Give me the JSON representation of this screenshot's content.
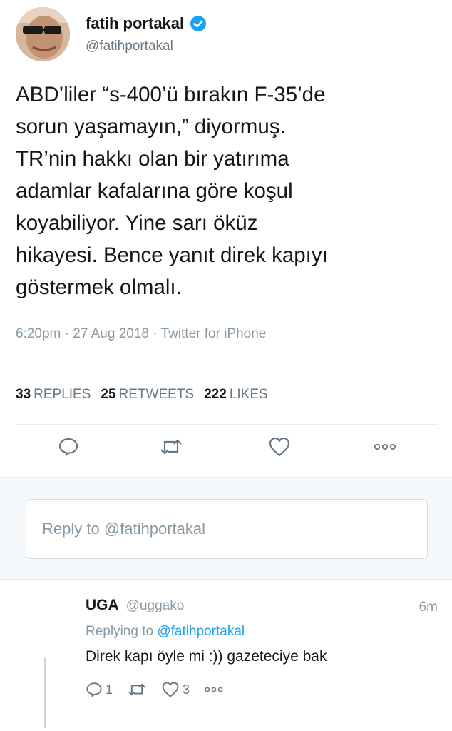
{
  "author": {
    "display_name": "fatih portakal",
    "handle": "@fatihportakal",
    "verified_icon": "verified-badge-icon"
  },
  "tweet": {
    "text": "ABD’liler “s-400’ü bırakın F-35’de\nsorun yaşamayın,” diyormuş.\nTR’nin hakkı olan bir yatırıma\nadamlar kafalarına göre koşul\nkoyabiliyor. Yine sarı öküz\nhikayesi. Bence yanıt direk kapıyı\ngöstermek olmalı.",
    "meta": "6:20pm · 27 Aug 2018 · Twitter for iPhone"
  },
  "stats": {
    "replies_count": "33",
    "replies_label": "REPLIES",
    "retweets_count": "25",
    "retweets_label": "RETWEETS",
    "likes_count": "222",
    "likes_label": "LIKES"
  },
  "actions": {
    "reply_icon": "reply-icon",
    "retweet_icon": "retweet-icon",
    "like_icon": "heart-icon",
    "more_icon": "more-icon"
  },
  "reply_box": {
    "placeholder": "Reply to @fatihportakal"
  },
  "reply_tweet": {
    "name": "UGA",
    "handle": "@uggako",
    "time": "6m",
    "replying_prefix": "Replying to",
    "replying_mention": "@fatihportakal",
    "text": "Direk kapı öyle mi :)) gazeteciye bak",
    "reply_count": "1",
    "like_count": "3"
  },
  "colors": {
    "accent": "#1da1f2",
    "muted": "#8899a6",
    "text": "#14171a"
  }
}
